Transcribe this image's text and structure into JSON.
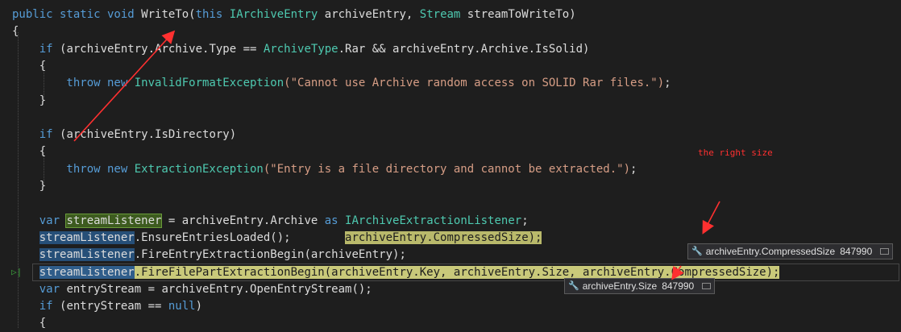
{
  "code_lines": [
    [
      {
        "t": "public static void ",
        "c": "kw"
      },
      {
        "t": "WriteTo",
        "c": "plain"
      },
      {
        "t": "(",
        "c": "plain"
      },
      {
        "t": "this ",
        "c": "kw"
      },
      {
        "t": "IArchiveEntry",
        "c": "type"
      },
      {
        "t": " archiveEntry, ",
        "c": "plain"
      },
      {
        "t": "Stream",
        "c": "type"
      },
      {
        "t": " streamToWriteTo)",
        "c": "plain"
      }
    ],
    [
      {
        "t": "{",
        "c": "plain"
      }
    ],
    [
      {
        "t": "    if ",
        "c": "kw"
      },
      {
        "t": "(archiveEntry.Archive.Type == ",
        "c": "plain"
      },
      {
        "t": "ArchiveType",
        "c": "type"
      },
      {
        "t": ".Rar && archiveEntry.Archive.IsSolid)",
        "c": "plain"
      }
    ],
    [
      {
        "t": "    {",
        "c": "plain"
      }
    ],
    [
      {
        "t": "        throw new ",
        "c": "kw"
      },
      {
        "t": "InvalidFormatException",
        "c": "type"
      },
      {
        "t": "(\"Cannot use Archive random access on SOLID Rar files.\")",
        "c": "str"
      },
      {
        "t": ";",
        "c": "plain"
      }
    ],
    [
      {
        "t": "    }",
        "c": "plain"
      }
    ],
    [],
    [
      {
        "t": "    if ",
        "c": "kw"
      },
      {
        "t": "(archiveEntry.IsDirectory)",
        "c": "plain"
      }
    ],
    [
      {
        "t": "    {",
        "c": "plain"
      }
    ],
    [
      {
        "t": "        throw new ",
        "c": "kw"
      },
      {
        "t": "ExtractionException",
        "c": "type"
      },
      {
        "t": "(\"Entry is a file directory and cannot be extracted.\")",
        "c": "str"
      },
      {
        "t": ";",
        "c": "plain"
      }
    ],
    [
      {
        "t": "    }",
        "c": "plain"
      }
    ],
    [],
    [
      {
        "t": "    var ",
        "c": "kw"
      },
      {
        "t": "streamListener",
        "c": "plain",
        "h": "hl-green"
      },
      {
        "t": " = archiveEntry.Archive ",
        "c": "plain"
      },
      {
        "t": "as ",
        "c": "kw"
      },
      {
        "t": "IArchiveExtractionListener",
        "c": "type"
      },
      {
        "t": ";",
        "c": "plain"
      }
    ],
    [
      {
        "t": "    ",
        "c": "plain"
      },
      {
        "t": "streamListener",
        "c": "plain",
        "h": "hl-blue"
      },
      {
        "t": ".EnsureEntriesLoaded();",
        "c": "plain"
      },
      {
        "t": "        ",
        "c": "plain"
      },
      {
        "t": "archiveEntry.CompressedSize);",
        "c": "plain",
        "h": "hl-yellow-text"
      }
    ],
    [
      {
        "t": "    ",
        "c": "plain"
      },
      {
        "t": "streamListener",
        "c": "plain",
        "h": "hl-blue"
      },
      {
        "t": ".FireEntryExtractionBegin(archiveEntry);",
        "c": "plain"
      }
    ],
    [
      {
        "t": "    ",
        "c": "plain"
      },
      {
        "t": "streamListener",
        "c": "plain",
        "h": "hl-blue-strong"
      },
      {
        "t": ".FireFilePartExtractionBegin(archiveEntry.Key, archiveEntry.Size, archiveEntry.CompressedSize);",
        "c": "plain",
        "h": "hl-yellow"
      }
    ],
    [
      {
        "t": "    var ",
        "c": "kw"
      },
      {
        "t": "entryStream = archiveEntry.OpenEntryStream();",
        "c": "plain"
      }
    ],
    [
      {
        "t": "    if ",
        "c": "kw"
      },
      {
        "t": "(entryStream == ",
        "c": "plain"
      },
      {
        "t": "null",
        "c": "kw"
      },
      {
        "t": ")",
        "c": "plain"
      }
    ],
    [
      {
        "t": "    {",
        "c": "plain"
      }
    ]
  ],
  "annotation": "the right size",
  "datatips": {
    "compressed": {
      "name": "archiveEntry.CompressedSize",
      "value": "847990"
    },
    "size": {
      "name": "archiveEntry.Size",
      "value": "847990"
    }
  },
  "colors": {
    "annotation_red": "#ff3030",
    "background": "#1e1e1e"
  },
  "icons": {
    "datatip": "wrench-icon",
    "pin": "pin-icon",
    "current_line": "current-statement-marker"
  }
}
